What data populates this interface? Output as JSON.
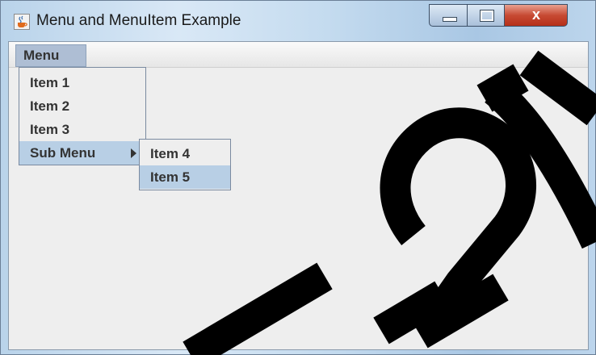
{
  "window": {
    "title": "Menu and MenuItem Example",
    "icon": "java-cup-icon",
    "controls": {
      "minimize": "minimize-icon",
      "maximize": "maximize-icon",
      "close": "x"
    }
  },
  "menubar": {
    "menu_label": "Menu"
  },
  "menu": {
    "items": [
      {
        "label": "Item 1"
      },
      {
        "label": "Item 2"
      },
      {
        "label": "Item 3"
      }
    ],
    "submenu": {
      "label": "Sub Menu",
      "items": [
        {
          "label": "Item 4",
          "selected": false
        },
        {
          "label": "Item 5",
          "selected": true
        }
      ]
    }
  },
  "colors": {
    "selection": "#b8cfe5",
    "menu_button_active": "#aebed4",
    "close_button": "#c74a33"
  }
}
